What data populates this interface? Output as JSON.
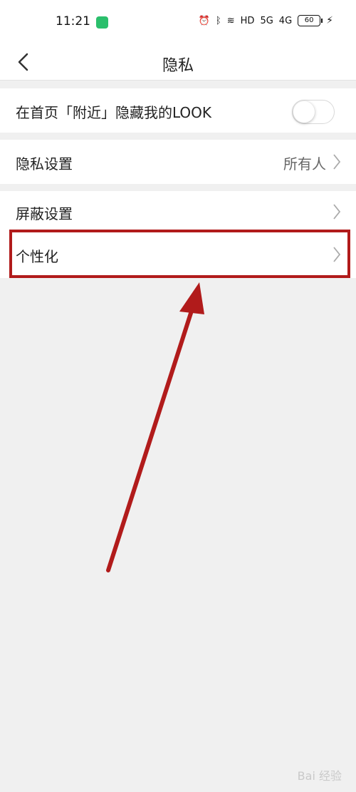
{
  "status_bar": {
    "time": "11:21",
    "icons": [
      "alarm-icon",
      "bluetooth-icon",
      "wifi-icon",
      "hd-icon",
      "5g-signal-icon",
      "4g-signal-icon",
      "battery-icon",
      "charging-icon"
    ],
    "hd_label": "HD",
    "signal_5g": "5G",
    "signal_4g": "4G",
    "battery_level": "60"
  },
  "nav": {
    "title": "隐私"
  },
  "settings": {
    "hide_look": {
      "label": "在首页「附近」隐藏我的LOOK",
      "enabled": false
    },
    "privacy": {
      "label": "隐私设置",
      "value": "所有人"
    },
    "block": {
      "label": "屏蔽设置"
    },
    "personalize": {
      "label": "个性化"
    }
  },
  "annotation": {
    "highlight_color": "#b11b1b",
    "arrow_color": "#b11b1b"
  },
  "watermark": {
    "text": "Bai 经验"
  }
}
